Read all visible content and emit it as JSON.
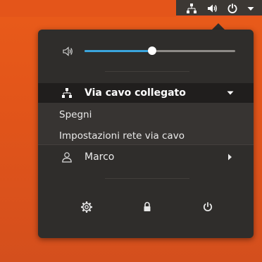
{
  "desktop": {
    "background_color": "#e4551a"
  },
  "topbar": {
    "indicators": [
      {
        "icon": "network-wired-icon"
      },
      {
        "icon": "speaker-volume-icon"
      },
      {
        "icon": "power-icon"
      },
      {
        "icon": "dropdown-arrow-icon"
      }
    ],
    "panel_color": "#3c3834",
    "accent_color": "#e95420"
  },
  "menu": {
    "background": "#2f2d2b",
    "volume": {
      "icon": "speaker-volume-icon",
      "level": 0.45,
      "fill_color": "#3ba5dd"
    },
    "wired": {
      "icon": "network-wired-icon",
      "label": "Via cavo collegato",
      "expanded": true,
      "items": [
        {
          "label": "Spegni"
        },
        {
          "label": "Impostazioni rete via cavo"
        }
      ]
    },
    "user": {
      "icon": "user-icon",
      "label": "Marco"
    },
    "actions": [
      {
        "icon": "settings-icon"
      },
      {
        "icon": "lock-icon"
      },
      {
        "icon": "power-icon"
      }
    ]
  }
}
